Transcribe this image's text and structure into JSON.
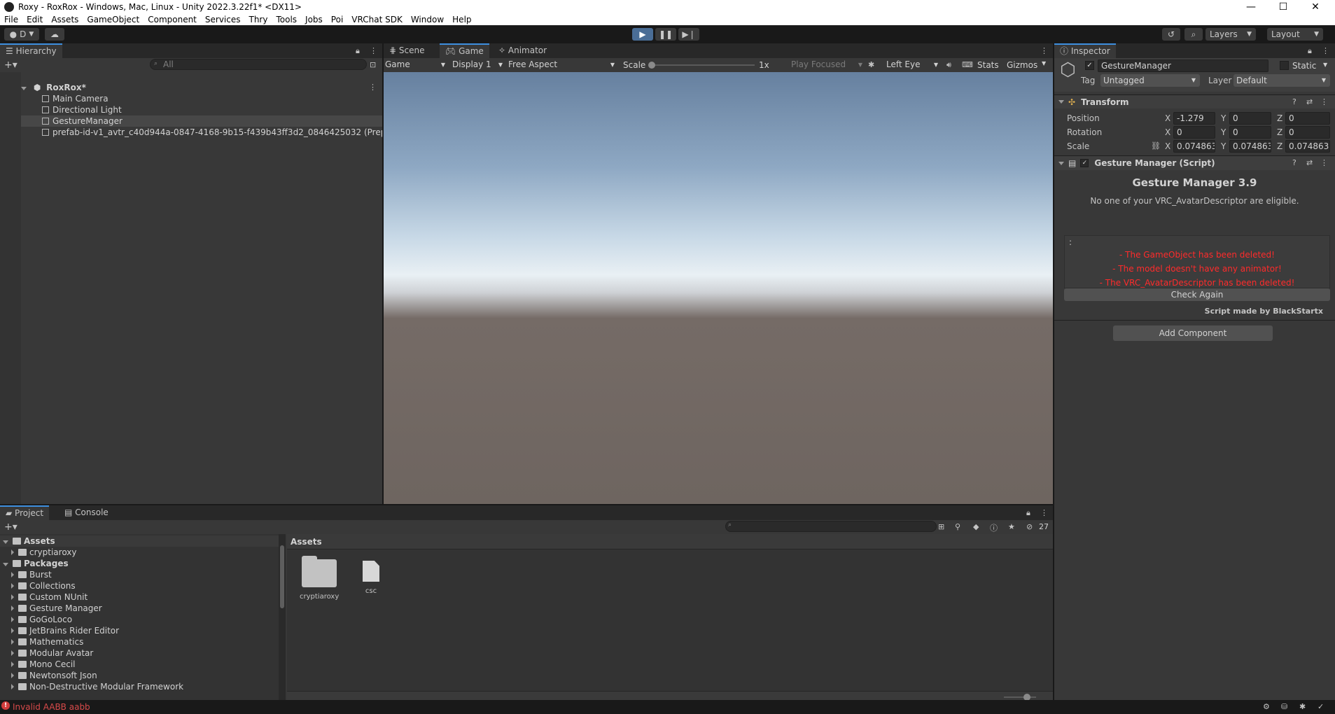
{
  "window": {
    "title": "Roxy - RoxRox - Windows, Mac, Linux - Unity 2022.3.22f1* <DX11>",
    "minimize": "—",
    "maximize": "☐",
    "close": "✕"
  },
  "menu": [
    "File",
    "Edit",
    "Assets",
    "GameObject",
    "Component",
    "Services",
    "Thry",
    "Tools",
    "Jobs",
    "Poi",
    "VRChat SDK",
    "Window",
    "Help"
  ],
  "toolbar": {
    "account": "D",
    "layers": "Layers",
    "layout": "Layout"
  },
  "hierarchy": {
    "tab": "Hierarchy",
    "search_placeholder": "All",
    "scene": "RoxRox*",
    "items": [
      "Main Camera",
      "Directional Light",
      "GestureManager",
      "prefab-id-v1_avtr_c40d944a-0847-4168-9b15-f439b43ff3d2_0846425032 (Prepr"
    ]
  },
  "view": {
    "tabs": [
      "Scene",
      "Game",
      "Animator"
    ],
    "game_dropdown": "Game",
    "display": "Display 1",
    "aspect": "Free Aspect",
    "scale_label": "Scale",
    "scale_value": "1x",
    "play_focused": "Play Focused",
    "eye": "Left Eye",
    "stats": "Stats",
    "gizmos": "Gizmos"
  },
  "inspector": {
    "tab": "Inspector",
    "object_name": "GestureManager",
    "static_label": "Static",
    "tag_label": "Tag",
    "tag_value": "Untagged",
    "layer_label": "Layer",
    "layer_value": "Default",
    "transform": {
      "header": "Transform",
      "position_label": "Position",
      "rotation_label": "Rotation",
      "scale_label": "Scale",
      "pos": [
        "-1.279",
        "0",
        "0"
      ],
      "rot": [
        "0",
        "0",
        "0"
      ],
      "scale": [
        "0.074863",
        "0.074863",
        "0.074863"
      ],
      "axis": [
        "X",
        "Y",
        "Z"
      ]
    },
    "gesture": {
      "header": "Gesture Manager (Script)",
      "title": "Gesture Manager 3.9",
      "subtitle": "No one of your VRC_AvatarDescriptor are eligible.",
      "box_marker": ":",
      "errors": [
        "- The GameObject has been deleted!",
        "- The model doesn't have any animator!",
        "- The VRC_AvatarDescriptor has been deleted!"
      ],
      "check_again": "Check Again",
      "credit": "Script made by BlackStartx"
    },
    "add_component": "Add Component"
  },
  "project": {
    "tabs": [
      "Project",
      "Console"
    ],
    "hidden_count": "27",
    "assets_root": "Assets",
    "assets_children": [
      "cryptiaroxy"
    ],
    "packages_root": "Packages",
    "packages": [
      "Burst",
      "Collections",
      "Custom NUnit",
      "Gesture Manager",
      "GoGoLoco",
      "JetBrains Rider Editor",
      "Mathematics",
      "Modular Avatar",
      "Mono Cecil",
      "Newtonsoft Json",
      "Non-Destructive Modular Framework"
    ],
    "breadcrumb": "Assets",
    "files": [
      {
        "name": "cryptiaroxy",
        "kind": "folder"
      },
      {
        "name": "csc",
        "kind": "file"
      }
    ]
  },
  "status": {
    "message": "Invalid AABB aabb"
  },
  "colors": {
    "accent": "#3d8fe0",
    "error": "#ff2b2b",
    "panel": "#383838",
    "play_active": "#4a6d96"
  }
}
